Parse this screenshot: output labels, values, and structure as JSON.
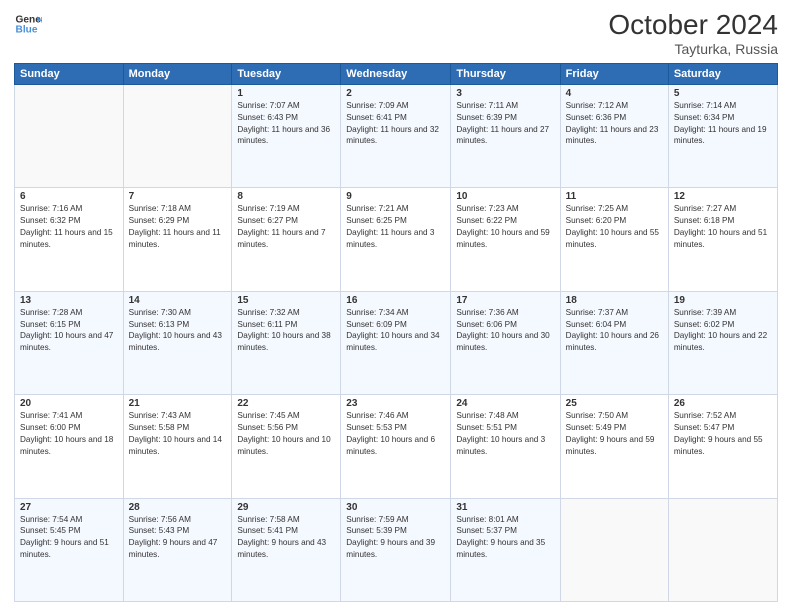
{
  "header": {
    "logo_line1": "General",
    "logo_line2": "Blue",
    "month_title": "October 2024",
    "location": "Tayturka, Russia"
  },
  "days_of_week": [
    "Sunday",
    "Monday",
    "Tuesday",
    "Wednesday",
    "Thursday",
    "Friday",
    "Saturday"
  ],
  "weeks": [
    [
      {
        "day": "",
        "info": ""
      },
      {
        "day": "",
        "info": ""
      },
      {
        "day": "1",
        "info": "Sunrise: 7:07 AM\nSunset: 6:43 PM\nDaylight: 11 hours and 36 minutes."
      },
      {
        "day": "2",
        "info": "Sunrise: 7:09 AM\nSunset: 6:41 PM\nDaylight: 11 hours and 32 minutes."
      },
      {
        "day": "3",
        "info": "Sunrise: 7:11 AM\nSunset: 6:39 PM\nDaylight: 11 hours and 27 minutes."
      },
      {
        "day": "4",
        "info": "Sunrise: 7:12 AM\nSunset: 6:36 PM\nDaylight: 11 hours and 23 minutes."
      },
      {
        "day": "5",
        "info": "Sunrise: 7:14 AM\nSunset: 6:34 PM\nDaylight: 11 hours and 19 minutes."
      }
    ],
    [
      {
        "day": "6",
        "info": "Sunrise: 7:16 AM\nSunset: 6:32 PM\nDaylight: 11 hours and 15 minutes."
      },
      {
        "day": "7",
        "info": "Sunrise: 7:18 AM\nSunset: 6:29 PM\nDaylight: 11 hours and 11 minutes."
      },
      {
        "day": "8",
        "info": "Sunrise: 7:19 AM\nSunset: 6:27 PM\nDaylight: 11 hours and 7 minutes."
      },
      {
        "day": "9",
        "info": "Sunrise: 7:21 AM\nSunset: 6:25 PM\nDaylight: 11 hours and 3 minutes."
      },
      {
        "day": "10",
        "info": "Sunrise: 7:23 AM\nSunset: 6:22 PM\nDaylight: 10 hours and 59 minutes."
      },
      {
        "day": "11",
        "info": "Sunrise: 7:25 AM\nSunset: 6:20 PM\nDaylight: 10 hours and 55 minutes."
      },
      {
        "day": "12",
        "info": "Sunrise: 7:27 AM\nSunset: 6:18 PM\nDaylight: 10 hours and 51 minutes."
      }
    ],
    [
      {
        "day": "13",
        "info": "Sunrise: 7:28 AM\nSunset: 6:15 PM\nDaylight: 10 hours and 47 minutes."
      },
      {
        "day": "14",
        "info": "Sunrise: 7:30 AM\nSunset: 6:13 PM\nDaylight: 10 hours and 43 minutes."
      },
      {
        "day": "15",
        "info": "Sunrise: 7:32 AM\nSunset: 6:11 PM\nDaylight: 10 hours and 38 minutes."
      },
      {
        "day": "16",
        "info": "Sunrise: 7:34 AM\nSunset: 6:09 PM\nDaylight: 10 hours and 34 minutes."
      },
      {
        "day": "17",
        "info": "Sunrise: 7:36 AM\nSunset: 6:06 PM\nDaylight: 10 hours and 30 minutes."
      },
      {
        "day": "18",
        "info": "Sunrise: 7:37 AM\nSunset: 6:04 PM\nDaylight: 10 hours and 26 minutes."
      },
      {
        "day": "19",
        "info": "Sunrise: 7:39 AM\nSunset: 6:02 PM\nDaylight: 10 hours and 22 minutes."
      }
    ],
    [
      {
        "day": "20",
        "info": "Sunrise: 7:41 AM\nSunset: 6:00 PM\nDaylight: 10 hours and 18 minutes."
      },
      {
        "day": "21",
        "info": "Sunrise: 7:43 AM\nSunset: 5:58 PM\nDaylight: 10 hours and 14 minutes."
      },
      {
        "day": "22",
        "info": "Sunrise: 7:45 AM\nSunset: 5:56 PM\nDaylight: 10 hours and 10 minutes."
      },
      {
        "day": "23",
        "info": "Sunrise: 7:46 AM\nSunset: 5:53 PM\nDaylight: 10 hours and 6 minutes."
      },
      {
        "day": "24",
        "info": "Sunrise: 7:48 AM\nSunset: 5:51 PM\nDaylight: 10 hours and 3 minutes."
      },
      {
        "day": "25",
        "info": "Sunrise: 7:50 AM\nSunset: 5:49 PM\nDaylight: 9 hours and 59 minutes."
      },
      {
        "day": "26",
        "info": "Sunrise: 7:52 AM\nSunset: 5:47 PM\nDaylight: 9 hours and 55 minutes."
      }
    ],
    [
      {
        "day": "27",
        "info": "Sunrise: 7:54 AM\nSunset: 5:45 PM\nDaylight: 9 hours and 51 minutes."
      },
      {
        "day": "28",
        "info": "Sunrise: 7:56 AM\nSunset: 5:43 PM\nDaylight: 9 hours and 47 minutes."
      },
      {
        "day": "29",
        "info": "Sunrise: 7:58 AM\nSunset: 5:41 PM\nDaylight: 9 hours and 43 minutes."
      },
      {
        "day": "30",
        "info": "Sunrise: 7:59 AM\nSunset: 5:39 PM\nDaylight: 9 hours and 39 minutes."
      },
      {
        "day": "31",
        "info": "Sunrise: 8:01 AM\nSunset: 5:37 PM\nDaylight: 9 hours and 35 minutes."
      },
      {
        "day": "",
        "info": ""
      },
      {
        "day": "",
        "info": ""
      }
    ]
  ]
}
